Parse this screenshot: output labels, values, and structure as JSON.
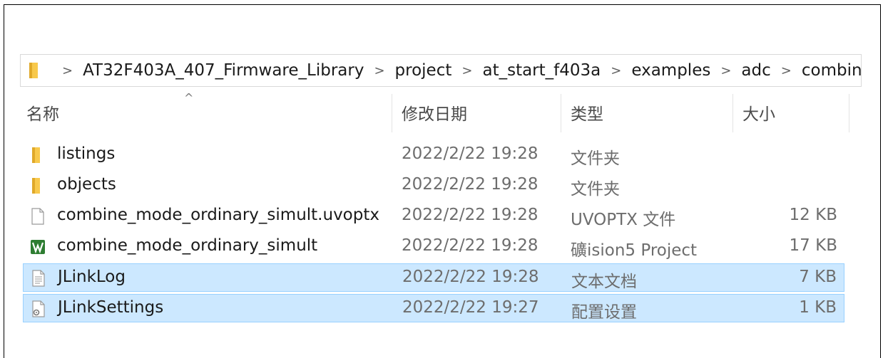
{
  "breadcrumb": {
    "folder_icon": "folder-icon",
    "separator": ">",
    "items": [
      "AT32F403A_407_Firmware_Library",
      "project",
      "at_start_f403a",
      "examples",
      "adc",
      "combine_m"
    ]
  },
  "columns": {
    "name": "名称",
    "date": "修改日期",
    "type": "类型",
    "size": "大小",
    "sort_indicator": "^"
  },
  "files": [
    {
      "name": "listings",
      "date": "2022/2/22 19:28",
      "type": "文件夹",
      "size": "",
      "icon": "folder-icon",
      "selected": false
    },
    {
      "name": "objects",
      "date": "2022/2/22 19:28",
      "type": "文件夹",
      "size": "",
      "icon": "folder-icon",
      "selected": false
    },
    {
      "name": "combine_mode_ordinary_simult.uvoptx",
      "date": "2022/2/22 19:28",
      "type": "UVOPTX 文件",
      "size": "12 KB",
      "icon": "blank-file-icon",
      "selected": false
    },
    {
      "name": "combine_mode_ordinary_simult",
      "date": "2022/2/22 19:28",
      "type": "礦ision5 Project",
      "size": "17 KB",
      "icon": "keil-uvision-icon",
      "selected": false
    },
    {
      "name": "JLinkLog",
      "date": "2022/2/22 19:28",
      "type": "文本文档",
      "size": "7 KB",
      "icon": "text-file-icon",
      "selected": true
    },
    {
      "name": "JLinkSettings",
      "date": "2022/2/22 19:27",
      "type": "配置设置",
      "size": "1 KB",
      "icon": "config-file-icon",
      "selected": true
    }
  ],
  "colors": {
    "selection_bg": "#cce8ff",
    "selection_border": "#99d1ff",
    "folder_yellow": "#f8c94c",
    "keil_green": "#2e7d32"
  }
}
